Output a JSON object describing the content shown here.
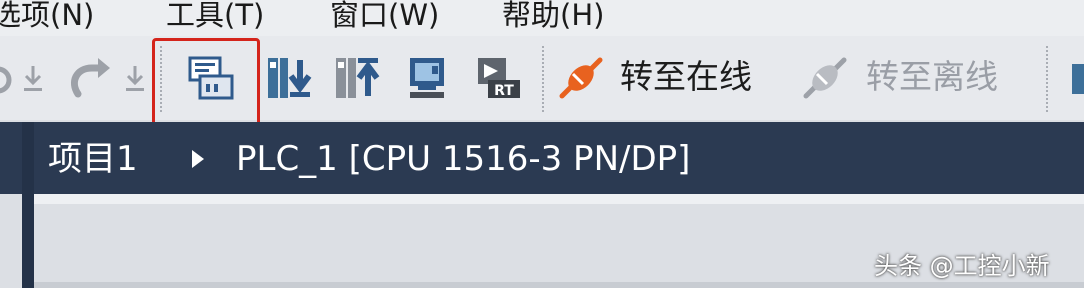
{
  "menu": {
    "items": [
      {
        "label": "选项(N)"
      },
      {
        "label": "工具(T)"
      },
      {
        "label": "窗口(W)"
      },
      {
        "label": "帮助(H)"
      }
    ]
  },
  "toolbar": {
    "go_online_label": "转至在线",
    "go_offline_label": "转至离线",
    "icons": [
      "redo-icon",
      "download-arrow-icon",
      "device-config-icon",
      "download-to-device-icon",
      "upload-from-device-icon",
      "compile-icon",
      "simulation-rt-icon",
      "go-online-icon",
      "go-offline-icon"
    ]
  },
  "breadcrumb": {
    "project": "项目1",
    "device": "PLC_1 [CPU 1516-3 PN/DP]"
  },
  "watermark": "头条 @工控小新",
  "colors": {
    "highlight": "#d4241b",
    "breadcrumb_bg": "#2b3a52",
    "online_orange": "#e8621f"
  }
}
